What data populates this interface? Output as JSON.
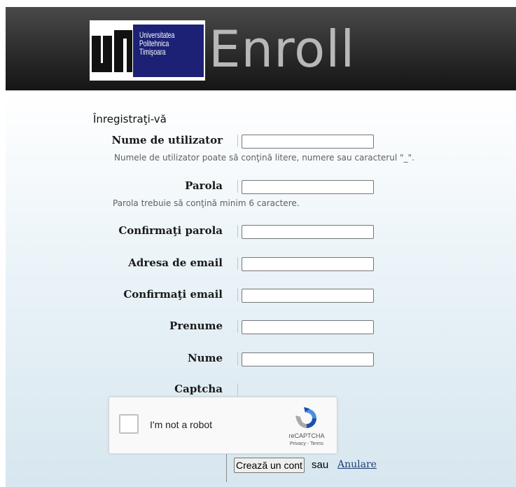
{
  "header": {
    "logo_lines": [
      "Universitatea",
      "Politehnica",
      "Timişoara"
    ],
    "title": "Enroll"
  },
  "form": {
    "heading": "Înregistraţi-vă",
    "fields": {
      "username": {
        "label": "Nume de utilizator",
        "value": "",
        "hint": "Numele de utilizator poate să conţină litere, numere sau caracterul \"_\"."
      },
      "password": {
        "label": "Parola",
        "value": "",
        "hint": "Parola trebuie să conţină minim 6 caractere."
      },
      "confirm_password": {
        "label": "Confirmaţi parola",
        "value": ""
      },
      "email": {
        "label": "Adresa de email",
        "value": ""
      },
      "confirm_email": {
        "label": "Confirmaţi email",
        "value": ""
      },
      "first_name": {
        "label": "Prenume",
        "value": ""
      },
      "last_name": {
        "label": "Nume",
        "value": ""
      }
    },
    "captcha": {
      "label": "Captcha",
      "checkbox_text": "I'm not a robot",
      "brand": "reCAPTCHA",
      "links": "Privacy - Terms"
    },
    "submit_label": "Crează un cont",
    "or_text": "sau",
    "cancel_label": "Anulare"
  },
  "colors": {
    "logo_blue": "#1c2175",
    "title_gray": "#b8b8b8",
    "link": "#1d3f73"
  }
}
